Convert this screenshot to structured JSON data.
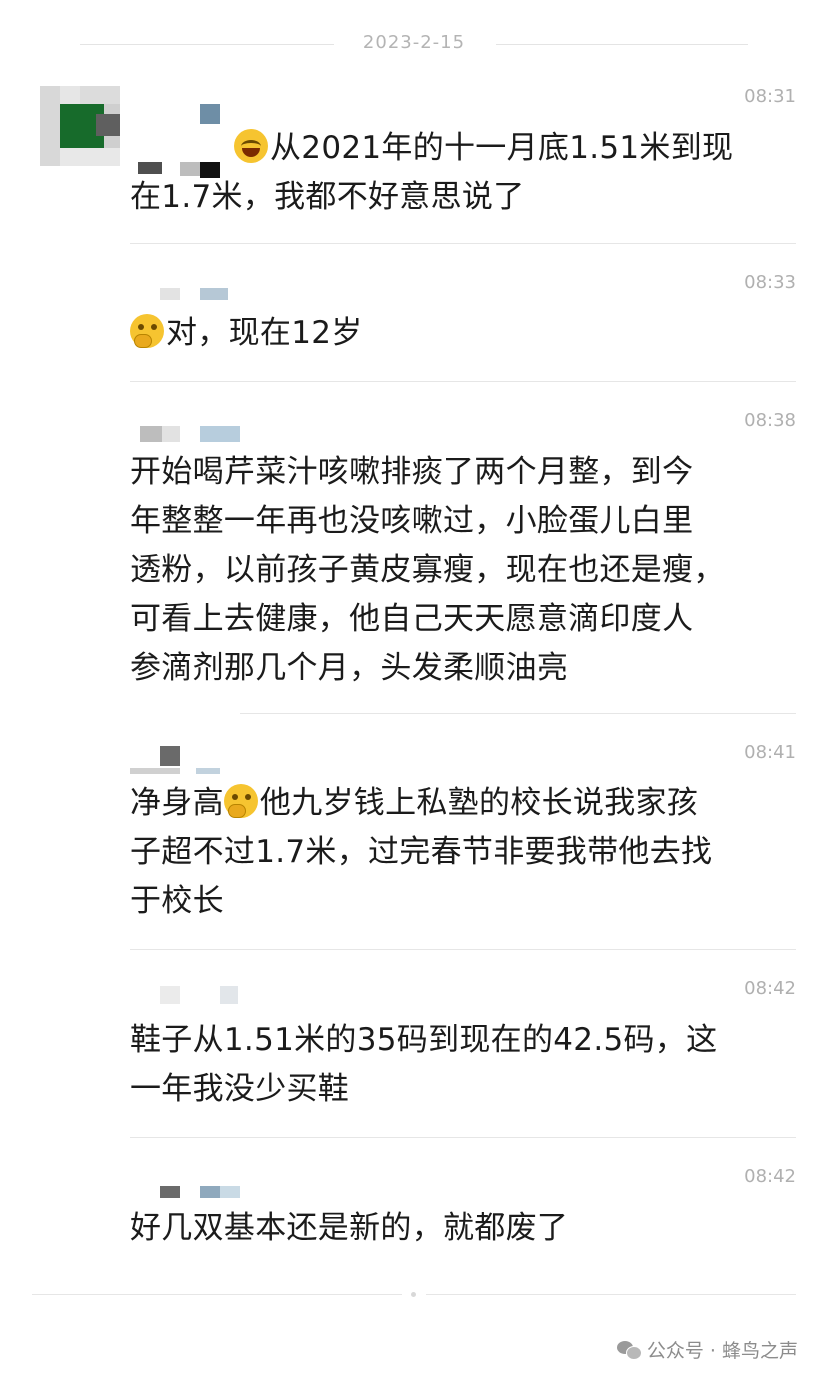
{
  "date_separator": "2023-2-15",
  "messages": [
    {
      "time": "08:31",
      "lines": [
        "从2021年的十一月底1.51米到现",
        "在1.7米，我都不好意思说了"
      ],
      "emoji": "face-with-tears-of-joy"
    },
    {
      "time": "08:33",
      "lines": [
        "对，现在12岁"
      ],
      "emoji": "thinking-face"
    },
    {
      "time": "08:38",
      "lines": [
        "开始喝芹菜汁咳嗽排痰了两个月整，到今",
        "年整整一年再也没咳嗽过，小脸蛋儿白里",
        "透粉，以前孩子黄皮寡瘦，现在也还是瘦，",
        "可看上去健康，他自己天天愿意滴印度人",
        "参滴剂那几个月，头发柔顺油亮"
      ]
    },
    {
      "time": "08:41",
      "line1_before": "净身高",
      "line1_after": "他九岁钱上私塾的校长说我家孩",
      "lines_rest": [
        "子超不过1.7米，过完春节非要我带他去找",
        "于校长"
      ],
      "emoji": "thinking-face"
    },
    {
      "time": "08:42",
      "lines": [
        "鞋子从1.51米的35码到现在的42.5码，这",
        "一年我没少买鞋"
      ]
    },
    {
      "time": "08:42",
      "lines": [
        "好几双基本还是新的，就都废了"
      ]
    }
  ],
  "watermark": {
    "text": "公众号 · 蜂鸟之声",
    "icon": "wechat-icon"
  }
}
